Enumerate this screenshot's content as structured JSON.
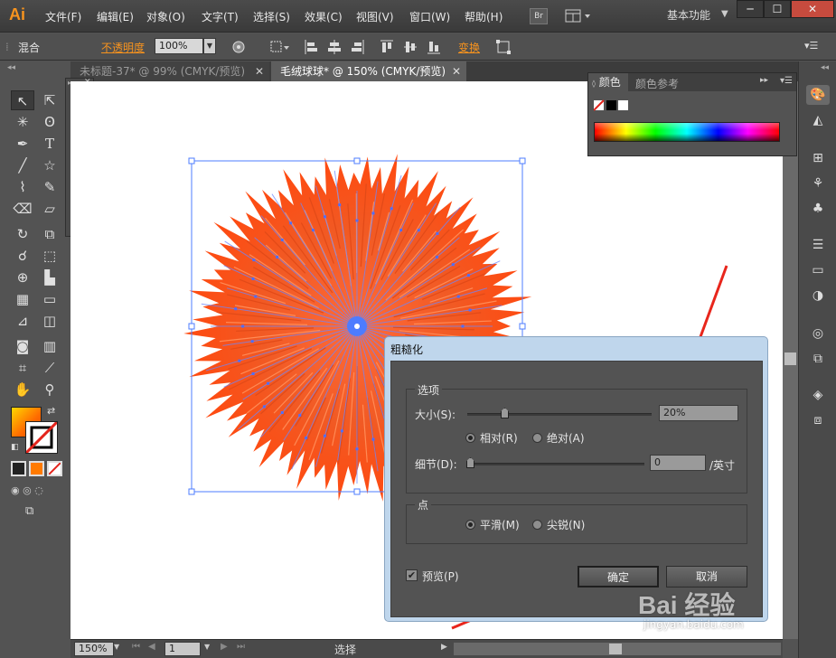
{
  "app": {
    "logo": "Ai",
    "workspace": "基本功能",
    "br_label": "Br"
  },
  "menu": [
    "文件(F)",
    "编辑(E)",
    "对象(O)",
    "文字(T)",
    "选择(S)",
    "效果(C)",
    "视图(V)",
    "窗口(W)",
    "帮助(H)"
  ],
  "window_buttons": [
    "─",
    "☐",
    "✕"
  ],
  "control_bar": {
    "mode": "混合",
    "opacity_label": "不透明度",
    "opacity_value": "100%",
    "transform_label": "变换"
  },
  "tabs": [
    {
      "label": "未标题-37* @ 99% (CMYK/预览)",
      "close": "✕",
      "active": false
    },
    {
      "label": "毛绒球球* @ 150% (CMYK/预览)",
      "close": "✕",
      "active": true
    }
  ],
  "color_panel": {
    "tab_color": "颜色",
    "tab_guide": "颜色参考"
  },
  "dialog": {
    "title": "粗糙化",
    "options_group": "选项",
    "size_label": "大小(S):",
    "size_value": "20%",
    "relative_label": "相对(R)",
    "absolute_label": "绝对(A)",
    "detail_label": "细节(D):",
    "detail_value": "0",
    "detail_unit": "/英寸",
    "point_group": "点",
    "smooth_label": "平滑(M)",
    "corner_label": "尖锐(N)",
    "preview_label": "预览(P)",
    "ok_label": "确定",
    "cancel_label": "取消"
  },
  "status": {
    "zoom": "150%",
    "page": "1",
    "tool": "选择"
  },
  "colors": {
    "accent_orange": "#ff5a1f",
    "selection_blue": "#3d6fff",
    "arrow_red": "#e8261c"
  },
  "watermark": {
    "brand": "Bai 经验",
    "url": "jingyan.baidu.com"
  }
}
